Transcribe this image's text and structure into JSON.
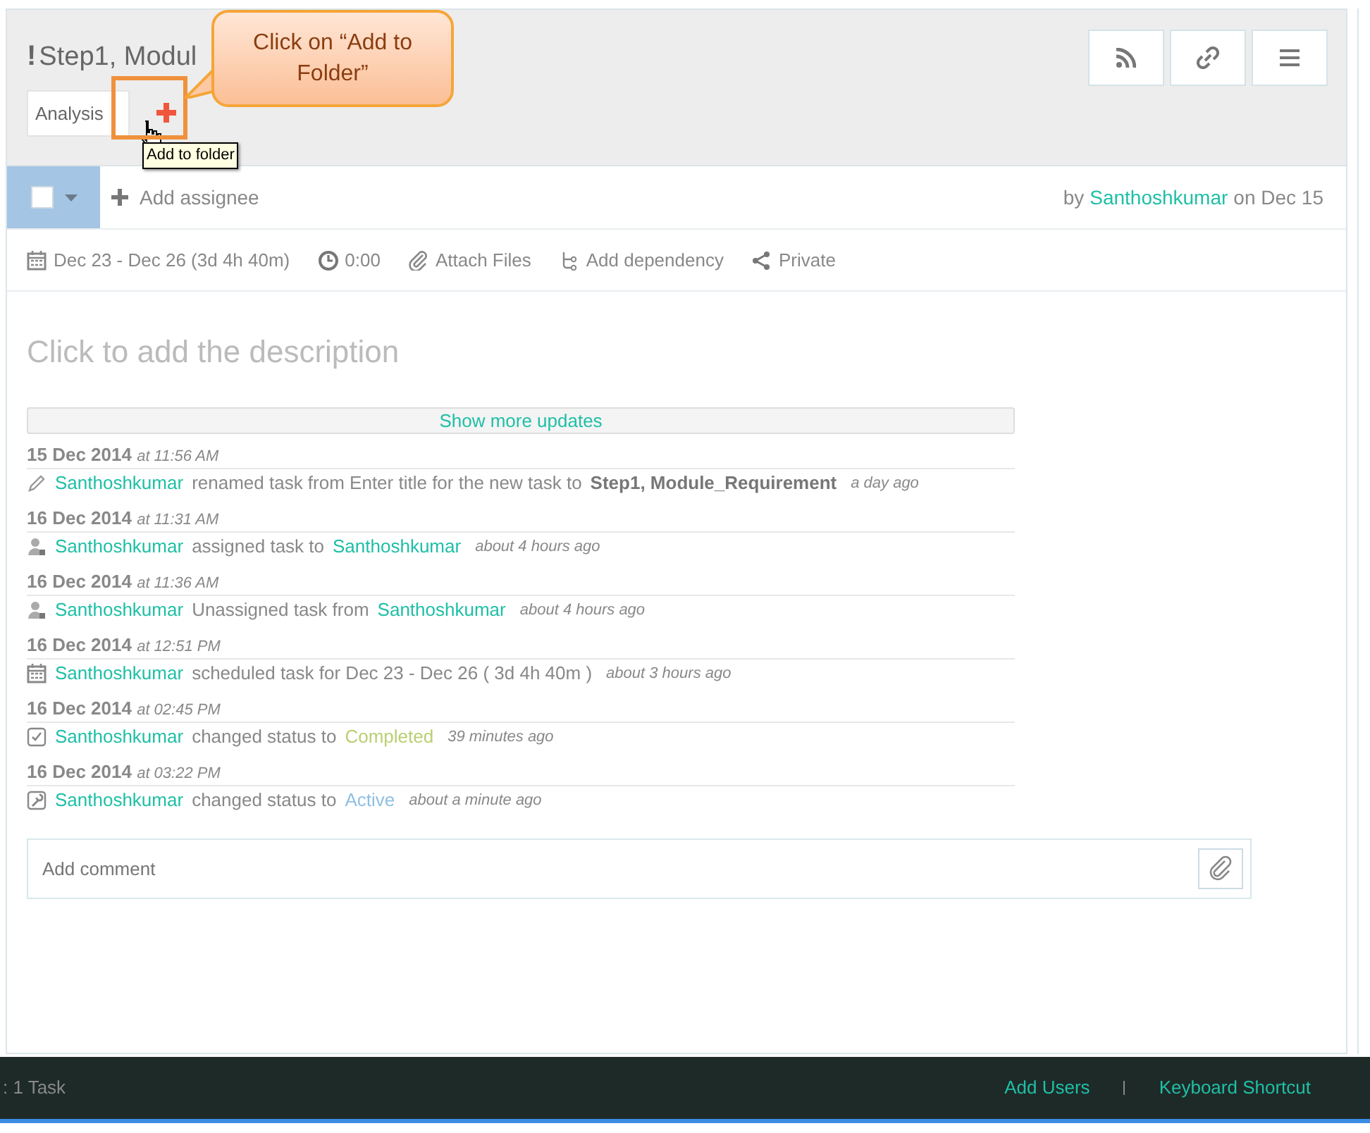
{
  "task": {
    "flag": "!",
    "title": "Step1, Modul",
    "folder": "Analysis",
    "add_folder_tooltip": "Add to folder",
    "checked": false,
    "add_assignee": "Add assignee",
    "author_prefix": "by",
    "author": "Santhoshkumar",
    "author_suffix": "on Dec 15"
  },
  "callout": {
    "text": "Click on “Add to Folder”"
  },
  "meta": [
    {
      "kind": "calendar",
      "label": "Dec 23 - Dec 26 (3d 4h 40m)"
    },
    {
      "kind": "clock",
      "label": "0:00"
    },
    {
      "kind": "clip",
      "label": "Attach Files"
    },
    {
      "kind": "dependency",
      "label": "Add dependency"
    },
    {
      "kind": "share",
      "label": "Private"
    }
  ],
  "description_placeholder": "Click to add the description",
  "show_more": "Show more updates",
  "updates": [
    {
      "date": "15 Dec 2014",
      "time": "at 11:56 AM",
      "kind": "rename",
      "parts": [
        {
          "kind": "user",
          "text": "Santhoshkumar"
        },
        {
          "kind": "text",
          "text": "renamed task from Enter title for the new task to"
        },
        {
          "kind": "bold",
          "text": "Step1, Module_Requirement"
        }
      ],
      "ago": "a day ago"
    },
    {
      "date": "16 Dec 2014",
      "time": "at 11:31 AM",
      "kind": "assign",
      "parts": [
        {
          "kind": "user",
          "text": "Santhoshkumar"
        },
        {
          "kind": "text",
          "text": "assigned task to"
        },
        {
          "kind": "user",
          "text": "Santhoshkumar"
        }
      ],
      "ago": "about 4 hours ago"
    },
    {
      "date": "16 Dec 2014",
      "time": "at 11:36 AM",
      "kind": "assign",
      "parts": [
        {
          "kind": "user",
          "text": "Santhoshkumar"
        },
        {
          "kind": "text",
          "text": "Unassigned task from"
        },
        {
          "kind": "user",
          "text": "Santhoshkumar"
        }
      ],
      "ago": "about 4 hours ago"
    },
    {
      "date": "16 Dec 2014",
      "time": "at 12:51 PM",
      "kind": "schedule",
      "parts": [
        {
          "kind": "user",
          "text": "Santhoshkumar"
        },
        {
          "kind": "text",
          "text": "scheduled task for Dec 23 - Dec 26 ( 3d 4h 40m )"
        }
      ],
      "ago": "about 3 hours ago"
    },
    {
      "date": "16 Dec 2014",
      "time": "at 02:45 PM",
      "kind": "complete",
      "parts": [
        {
          "kind": "user",
          "text": "Santhoshkumar"
        },
        {
          "kind": "text",
          "text": "changed status to"
        },
        {
          "kind": "status",
          "text": "Completed",
          "color": "#b9cf72"
        }
      ],
      "ago": "39 minutes ago"
    },
    {
      "date": "16 Dec 2014",
      "time": "at 03:22 PM",
      "kind": "activate",
      "parts": [
        {
          "kind": "user",
          "text": "Santhoshkumar"
        },
        {
          "kind": "text",
          "text": "changed status to"
        },
        {
          "kind": "status",
          "text": "Active",
          "color": "#8fbfe3"
        }
      ],
      "ago": "about a minute ago"
    }
  ],
  "comment_placeholder": "Add comment",
  "footer": {
    "count": ": 1 Task",
    "links": [
      "Add Users",
      "Keyboard Shortcut"
    ]
  }
}
